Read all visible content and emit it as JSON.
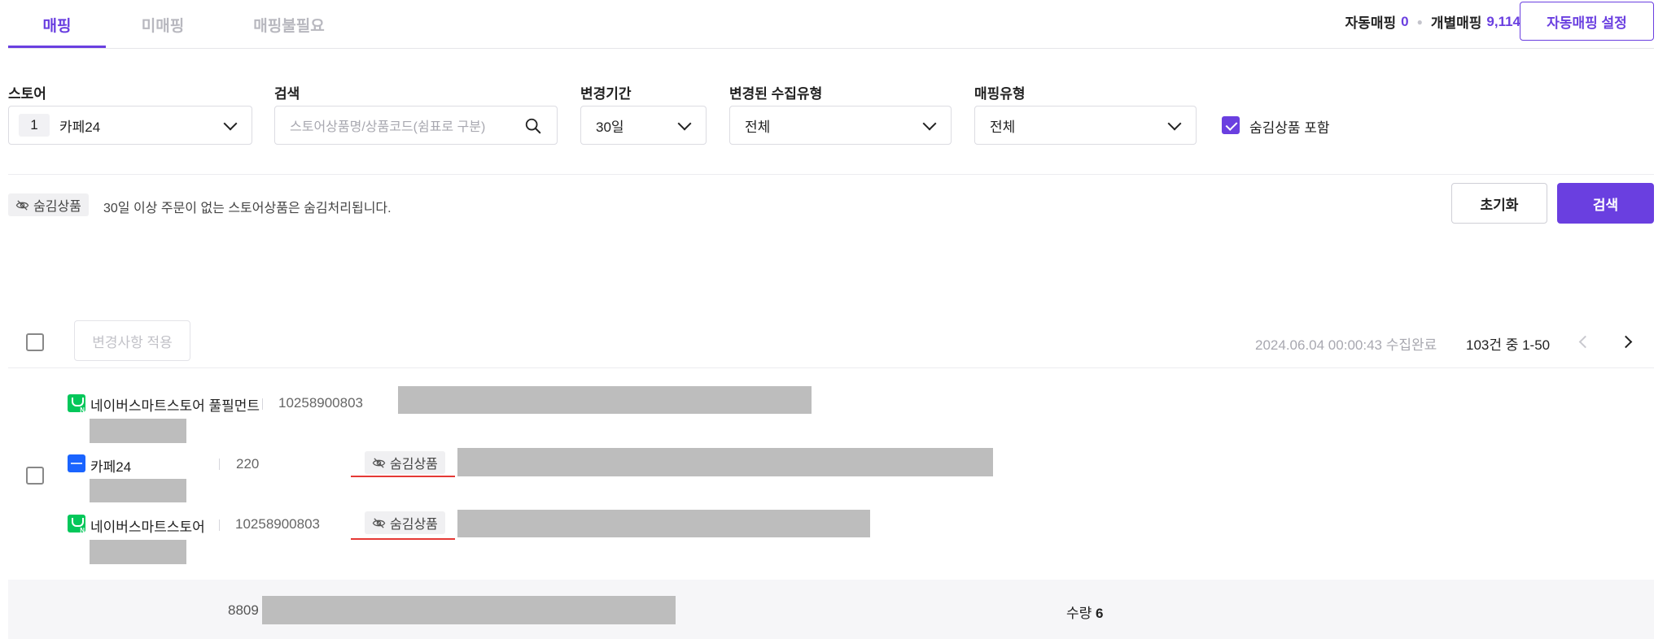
{
  "tabs": [
    {
      "label": "매핑",
      "active": true
    },
    {
      "label": "미매핑",
      "active": false
    },
    {
      "label": "매핑불필요",
      "active": false
    }
  ],
  "mapping_summary": {
    "auto_label": "자동매핑",
    "auto_count": "0",
    "individual_label": "개별매핑",
    "individual_count": "9,114"
  },
  "auto_mapping_button": "자동매핑 설정",
  "filters": {
    "store": {
      "label": "스토어",
      "count": "1",
      "value": "카페24"
    },
    "search": {
      "label": "검색",
      "placeholder": "스토어상품명/상품코드(쉼표로 구분)"
    },
    "period": {
      "label": "변경기간",
      "value": "30일"
    },
    "collect_type": {
      "label": "변경된 수집유형",
      "value": "전체"
    },
    "mapping_type": {
      "label": "매핑유형",
      "value": "전체"
    },
    "include_hidden": {
      "label": "숨김상품 포함",
      "checked": true
    }
  },
  "hidden_notice": {
    "tag": "숨김상품",
    "text": "30일 이상 주문이 없는 스토어상품은 숨김처리됩니다."
  },
  "buttons": {
    "reset": "초기화",
    "search": "검색",
    "apply_changes": "변경사항 적용"
  },
  "list_header": {
    "collected_at": "2024.06.04 00:00:43 수집완료",
    "page_info": "103건 중 1-50"
  },
  "rows": [
    {
      "store": "네이버스마트스토어 풀필먼트",
      "store_icon": "naver-icon",
      "code": "10258900803"
    },
    {
      "store": "카페24",
      "store_icon": "cafe24-icon",
      "code": "220",
      "hidden_tag": "숨김상품"
    },
    {
      "store": "네이버스마트스토어",
      "store_icon": "naver-icon",
      "code": "10258900803",
      "hidden_tag": "숨김상품"
    }
  ],
  "summary": {
    "barcode_prefix": "8809",
    "qty_label": "수량",
    "qty_value": "6"
  },
  "colors": {
    "accent": "#6a3fe0",
    "naver": "#03c75a",
    "cafe24": "#1a64ff",
    "annotation": "#e53935"
  }
}
